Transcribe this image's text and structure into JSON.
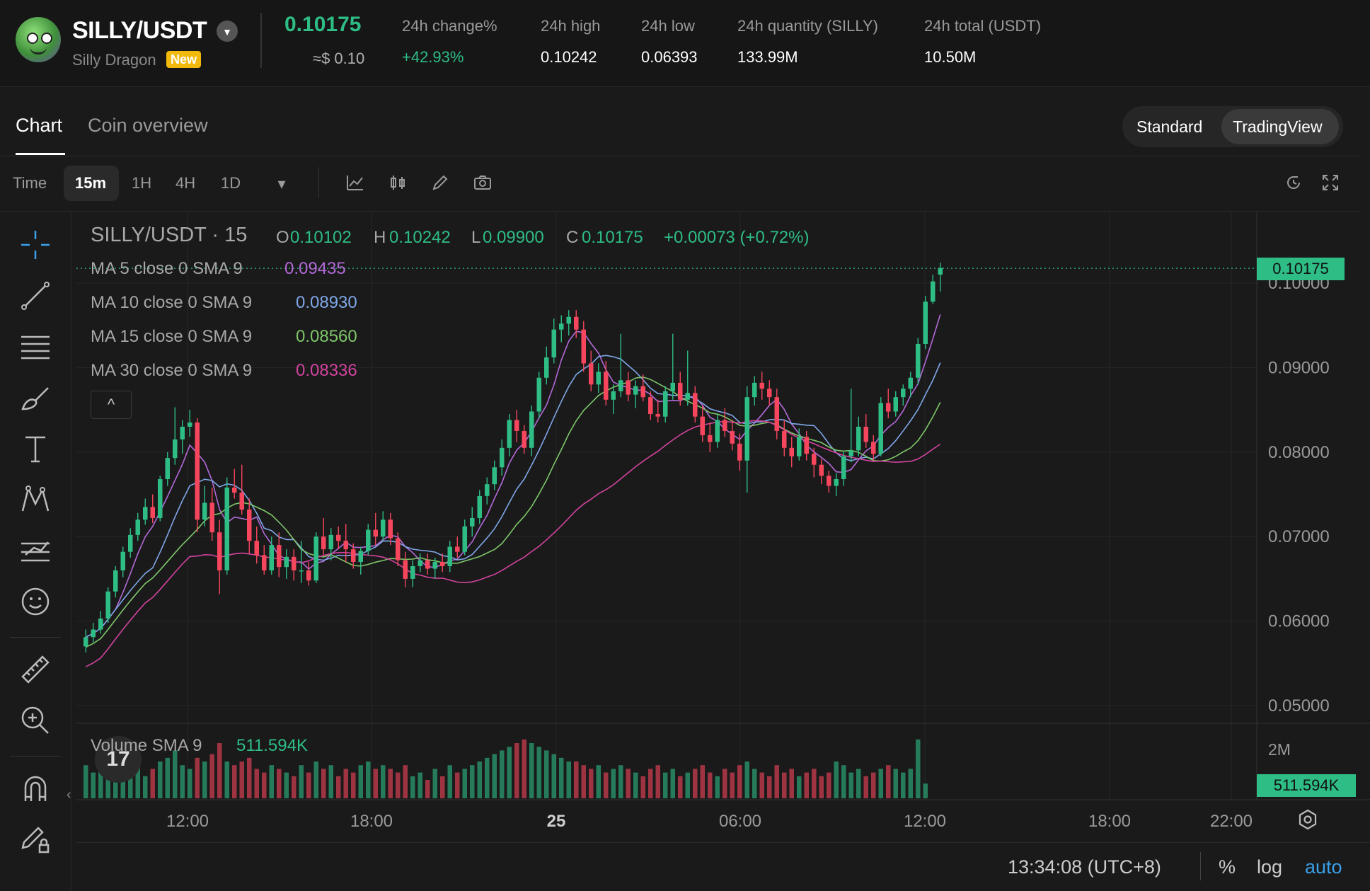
{
  "header": {
    "pair": "SILLY/USDT",
    "coin_name": "Silly Dragon",
    "badge": "New",
    "last_price": "0.10175",
    "last_price_fiat": "≈$ 0.10",
    "stats": [
      {
        "label": "24h change%",
        "value": "+42.93%",
        "color": "#2ebd85"
      },
      {
        "label": "24h high",
        "value": "0.10242",
        "color": "#ffffff"
      },
      {
        "label": "24h low",
        "value": "0.06393",
        "color": "#ffffff"
      },
      {
        "label": "24h quantity (SILLY)",
        "value": "133.99M",
        "color": "#ffffff"
      },
      {
        "label": "24h total (USDT)",
        "value": "10.50M",
        "color": "#ffffff"
      }
    ]
  },
  "tabs": {
    "chart": "Chart",
    "overview": "Coin overview"
  },
  "view_toggle": {
    "standard": "Standard",
    "tradingview": "TradingView"
  },
  "timeframes": {
    "time_label": "Time",
    "items": [
      "15m",
      "1H",
      "4H",
      "1D"
    ],
    "active": "15m"
  },
  "legend": {
    "title": "SILLY/USDT · 15",
    "ohlc": {
      "o_label": "O",
      "o": "0.10102",
      "h_label": "H",
      "h": "0.10242",
      "l_label": "L",
      "l": "0.09900",
      "c_label": "C",
      "c": "0.10175",
      "change": "+0.00073 (+0.72%)"
    },
    "ma": [
      {
        "label": "MA 5 close 0 SMA 9",
        "value": "0.09435",
        "color": "#b36ad9"
      },
      {
        "label": "MA 10 close 0 SMA 9",
        "value": "0.08930",
        "color": "#7fa7e8"
      },
      {
        "label": "MA 15 close 0 SMA 9",
        "value": "0.08560",
        "color": "#7ec66a"
      },
      {
        "label": "MA 30 close 0 SMA 9",
        "value": "0.08336",
        "color": "#d2439f"
      }
    ],
    "collapse": "^"
  },
  "price_tag": "0.10175",
  "volume": {
    "label": "Volume SMA 9",
    "value": "511.594K",
    "axis": "2M",
    "tag": "511.594K"
  },
  "bottom": {
    "time": "13:34:08 (UTC+8)",
    "percent": "%",
    "log": "log",
    "auto": "auto"
  },
  "colors": {
    "up": "#2ebd85",
    "down": "#f6465d",
    "bg": "#1a1a1a"
  },
  "chart_data": {
    "type": "candlestick",
    "y_ticks": [
      "0.10000",
      "0.09000",
      "0.08000",
      "0.07000",
      "0.06000",
      "0.05000"
    ],
    "ylim": [
      0.05,
      0.1
    ],
    "x_ticks": [
      "12:00",
      "18:00",
      "25",
      "06:00",
      "12:00",
      "18:00",
      "22:00"
    ],
    "candles": [
      [
        0.057,
        0.059,
        0.0563,
        0.0581
      ],
      [
        0.0581,
        0.0598,
        0.0575,
        0.059
      ],
      [
        0.059,
        0.0612,
        0.0585,
        0.0603
      ],
      [
        0.0603,
        0.064,
        0.0598,
        0.0635
      ],
      [
        0.0635,
        0.0665,
        0.0628,
        0.066
      ],
      [
        0.066,
        0.0688,
        0.0652,
        0.0682
      ],
      [
        0.0682,
        0.071,
        0.0675,
        0.0702
      ],
      [
        0.0702,
        0.0728,
        0.0695,
        0.072
      ],
      [
        0.072,
        0.0745,
        0.0714,
        0.0735
      ],
      [
        0.0735,
        0.075,
        0.0716,
        0.0722
      ],
      [
        0.0722,
        0.0772,
        0.0718,
        0.0768
      ],
      [
        0.0768,
        0.08,
        0.076,
        0.0793
      ],
      [
        0.0793,
        0.0853,
        0.0785,
        0.0815
      ],
      [
        0.0815,
        0.0838,
        0.0798,
        0.083
      ],
      [
        0.083,
        0.085,
        0.0818,
        0.0835
      ],
      [
        0.0835,
        0.084,
        0.0705,
        0.072
      ],
      [
        0.072,
        0.076,
        0.0712,
        0.074
      ],
      [
        0.074,
        0.0758,
        0.0695,
        0.0705
      ],
      [
        0.0705,
        0.072,
        0.0632,
        0.066
      ],
      [
        0.066,
        0.077,
        0.0655,
        0.0758
      ],
      [
        0.0758,
        0.078,
        0.0745,
        0.0752
      ],
      [
        0.0752,
        0.0785,
        0.0726,
        0.0732
      ],
      [
        0.0732,
        0.0745,
        0.068,
        0.0695
      ],
      [
        0.0695,
        0.0712,
        0.0668,
        0.0678
      ],
      [
        0.0678,
        0.069,
        0.0655,
        0.066
      ],
      [
        0.066,
        0.07,
        0.0655,
        0.069
      ],
      [
        0.069,
        0.0705,
        0.0652,
        0.0664
      ],
      [
        0.0664,
        0.0685,
        0.065,
        0.0676
      ],
      [
        0.0676,
        0.0685,
        0.0648,
        0.066
      ],
      [
        0.066,
        0.0695,
        0.0645,
        0.066
      ],
      [
        0.066,
        0.067,
        0.0642,
        0.0648
      ],
      [
        0.0648,
        0.0705,
        0.0645,
        0.07
      ],
      [
        0.07,
        0.0722,
        0.0678,
        0.0685
      ],
      [
        0.0685,
        0.071,
        0.0672,
        0.0702
      ],
      [
        0.0702,
        0.0712,
        0.0685,
        0.0695
      ],
      [
        0.0695,
        0.0715,
        0.067,
        0.0685
      ],
      [
        0.0685,
        0.0692,
        0.0662,
        0.067
      ],
      [
        0.067,
        0.0688,
        0.0655,
        0.0683
      ],
      [
        0.0683,
        0.0715,
        0.0678,
        0.0708
      ],
      [
        0.0708,
        0.0728,
        0.069,
        0.07
      ],
      [
        0.07,
        0.073,
        0.0695,
        0.072
      ],
      [
        0.072,
        0.0728,
        0.069,
        0.0698
      ],
      [
        0.0698,
        0.0705,
        0.0665,
        0.0672
      ],
      [
        0.0672,
        0.0682,
        0.064,
        0.065
      ],
      [
        0.065,
        0.0672,
        0.064,
        0.0665
      ],
      [
        0.0665,
        0.068,
        0.0658,
        0.0672
      ],
      [
        0.0672,
        0.068,
        0.0655,
        0.0662
      ],
      [
        0.0662,
        0.0675,
        0.065,
        0.067
      ],
      [
        0.067,
        0.068,
        0.0658,
        0.0665
      ],
      [
        0.0665,
        0.0695,
        0.0658,
        0.0688
      ],
      [
        0.0688,
        0.07,
        0.0675,
        0.0682
      ],
      [
        0.0682,
        0.072,
        0.0678,
        0.0712
      ],
      [
        0.0712,
        0.0735,
        0.07,
        0.0722
      ],
      [
        0.0722,
        0.0755,
        0.0715,
        0.0748
      ],
      [
        0.0748,
        0.077,
        0.0738,
        0.0762
      ],
      [
        0.0762,
        0.079,
        0.0755,
        0.0782
      ],
      [
        0.0782,
        0.0815,
        0.0772,
        0.0805
      ],
      [
        0.0805,
        0.0845,
        0.0795,
        0.0838
      ],
      [
        0.0838,
        0.085,
        0.0812,
        0.0825
      ],
      [
        0.0825,
        0.0832,
        0.0798,
        0.0805
      ],
      [
        0.0805,
        0.0855,
        0.0795,
        0.0848
      ],
      [
        0.0848,
        0.0895,
        0.084,
        0.0888
      ],
      [
        0.0888,
        0.0925,
        0.088,
        0.0912
      ],
      [
        0.0912,
        0.0958,
        0.0905,
        0.0945
      ],
      [
        0.0945,
        0.0962,
        0.093,
        0.0952
      ],
      [
        0.0952,
        0.0968,
        0.0938,
        0.096
      ],
      [
        0.096,
        0.0968,
        0.0935,
        0.0945
      ],
      [
        0.0945,
        0.0955,
        0.0895,
        0.0905
      ],
      [
        0.0905,
        0.092,
        0.0872,
        0.088
      ],
      [
        0.088,
        0.0905,
        0.087,
        0.0895
      ],
      [
        0.0895,
        0.0908,
        0.0855,
        0.0862
      ],
      [
        0.0862,
        0.088,
        0.0845,
        0.0872
      ],
      [
        0.0872,
        0.094,
        0.0865,
        0.0885
      ],
      [
        0.0885,
        0.0895,
        0.086,
        0.0868
      ],
      [
        0.0868,
        0.0885,
        0.0852,
        0.0878
      ],
      [
        0.0878,
        0.0892,
        0.086,
        0.0865
      ],
      [
        0.0865,
        0.0872,
        0.0838,
        0.0845
      ],
      [
        0.0845,
        0.0862,
        0.0835,
        0.0842
      ],
      [
        0.0842,
        0.0878,
        0.0835,
        0.0872
      ],
      [
        0.0872,
        0.094,
        0.0862,
        0.0882
      ],
      [
        0.0882,
        0.0895,
        0.0855,
        0.0862
      ],
      [
        0.0862,
        0.092,
        0.0855,
        0.087
      ],
      [
        0.087,
        0.0878,
        0.0835,
        0.0842
      ],
      [
        0.0842,
        0.0855,
        0.0812,
        0.082
      ],
      [
        0.082,
        0.0835,
        0.08,
        0.0812
      ],
      [
        0.0812,
        0.0845,
        0.0805,
        0.0838
      ],
      [
        0.0838,
        0.0852,
        0.0818,
        0.0825
      ],
      [
        0.0825,
        0.0838,
        0.0802,
        0.081
      ],
      [
        0.081,
        0.0822,
        0.0778,
        0.079
      ],
      [
        0.079,
        0.0878,
        0.0752,
        0.0865
      ],
      [
        0.0865,
        0.089,
        0.0855,
        0.0882
      ],
      [
        0.0882,
        0.0895,
        0.0862,
        0.0875
      ],
      [
        0.0875,
        0.0885,
        0.0855,
        0.0865
      ],
      [
        0.0865,
        0.0875,
        0.0815,
        0.0825
      ],
      [
        0.0825,
        0.0838,
        0.0795,
        0.0805
      ],
      [
        0.0805,
        0.0818,
        0.0782,
        0.0795
      ],
      [
        0.0795,
        0.0828,
        0.079,
        0.0818
      ],
      [
        0.0818,
        0.0825,
        0.079,
        0.0798
      ],
      [
        0.0798,
        0.0805,
        0.077,
        0.0785
      ],
      [
        0.0785,
        0.0792,
        0.0762,
        0.0772
      ],
      [
        0.0772,
        0.0778,
        0.0752,
        0.076
      ],
      [
        0.076,
        0.0775,
        0.0748,
        0.0768
      ],
      [
        0.0768,
        0.08,
        0.076,
        0.0795
      ],
      [
        0.0795,
        0.0875,
        0.0788,
        0.0802
      ],
      [
        0.0802,
        0.0842,
        0.0795,
        0.083
      ],
      [
        0.083,
        0.0845,
        0.0805,
        0.0812
      ],
      [
        0.0812,
        0.082,
        0.079,
        0.0798
      ],
      [
        0.0798,
        0.0865,
        0.0795,
        0.0858
      ],
      [
        0.0858,
        0.0875,
        0.084,
        0.0848
      ],
      [
        0.0848,
        0.0872,
        0.0842,
        0.0865
      ],
      [
        0.0865,
        0.088,
        0.0855,
        0.0875
      ],
      [
        0.0875,
        0.0895,
        0.0865,
        0.0888
      ],
      [
        0.0888,
        0.0935,
        0.088,
        0.0928
      ],
      [
        0.0928,
        0.0985,
        0.0922,
        0.0978
      ],
      [
        0.0978,
        0.101,
        0.0975,
        0.1002
      ],
      [
        0.101,
        0.1024,
        0.099,
        0.1018
      ]
    ],
    "volume": [
      0.9,
      0.7,
      0.8,
      0.6,
      0.9,
      0.8,
      0.7,
      0.9,
      0.6,
      0.8,
      1.0,
      1.1,
      1.3,
      0.9,
      0.8,
      1.1,
      1.0,
      1.2,
      1.5,
      1.0,
      0.9,
      1.0,
      1.1,
      0.8,
      0.7,
      0.9,
      0.8,
      0.7,
      0.6,
      0.9,
      0.7,
      1.0,
      0.8,
      0.9,
      0.6,
      0.8,
      0.7,
      0.9,
      1.0,
      0.8,
      0.9,
      0.8,
      0.7,
      0.9,
      0.6,
      0.7,
      0.5,
      0.8,
      0.6,
      0.9,
      0.7,
      0.8,
      0.9,
      1.0,
      1.1,
      1.2,
      1.3,
      1.4,
      1.5,
      1.6,
      1.5,
      1.4,
      1.3,
      1.2,
      1.1,
      1.0,
      1.0,
      0.9,
      0.8,
      0.9,
      0.7,
      0.8,
      0.9,
      0.8,
      0.7,
      0.6,
      0.8,
      0.9,
      0.7,
      0.8,
      0.6,
      0.7,
      0.8,
      0.9,
      0.7,
      0.6,
      0.8,
      0.7,
      0.9,
      1.0,
      0.8,
      0.7,
      0.6,
      0.9,
      0.7,
      0.8,
      0.6,
      0.7,
      0.8,
      0.6,
      0.7,
      1.0,
      0.9,
      0.7,
      0.8,
      0.6,
      0.7,
      0.8,
      0.9,
      0.8,
      0.7,
      0.8,
      1.6,
      0.4
    ]
  }
}
